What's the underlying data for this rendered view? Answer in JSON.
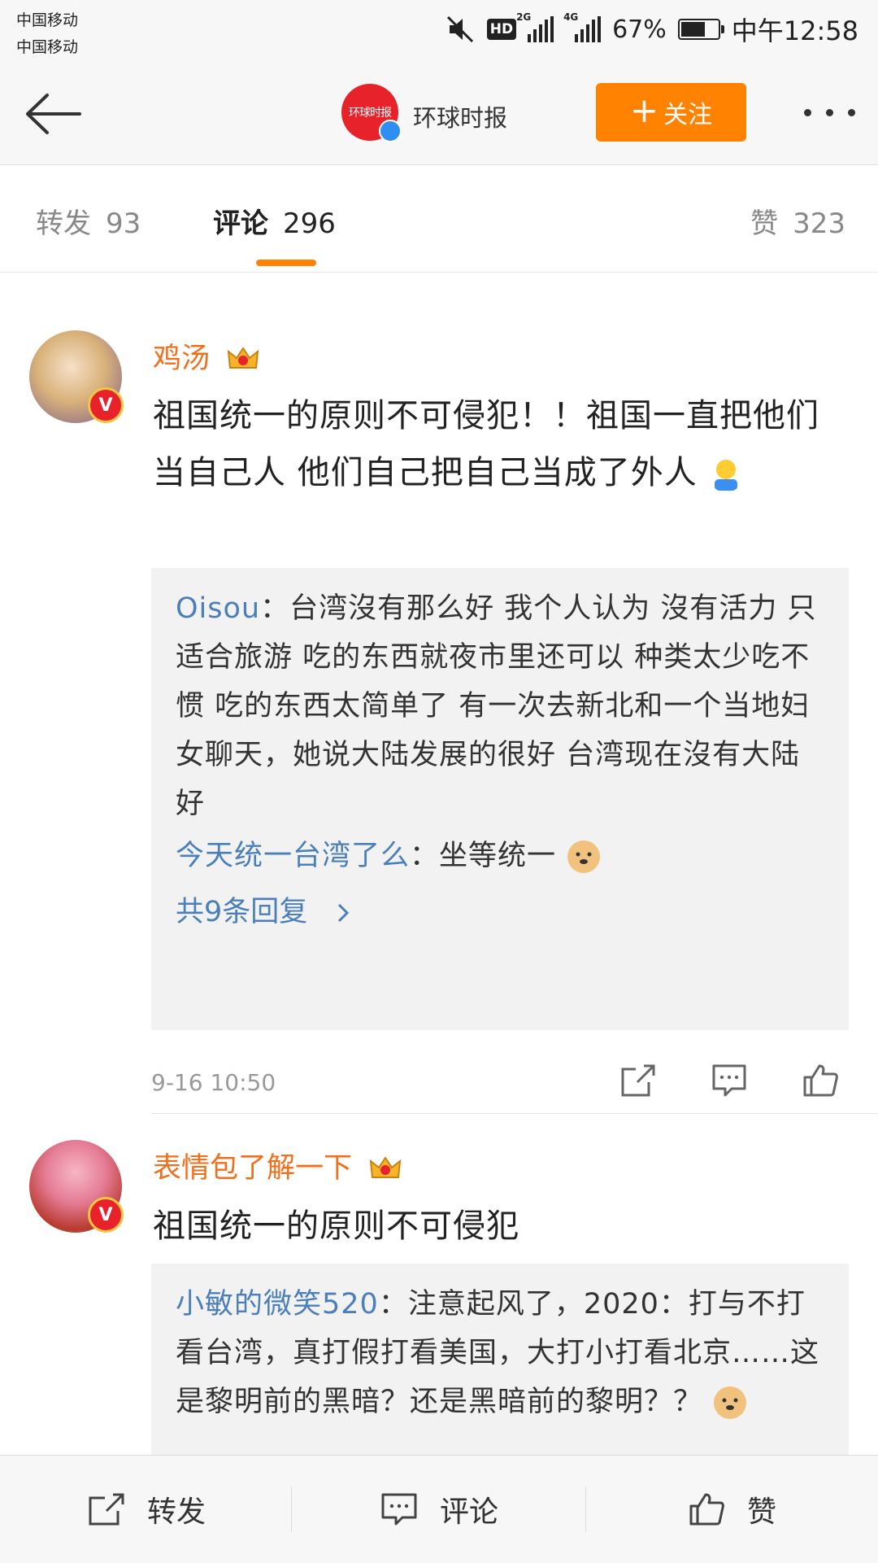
{
  "status_bar": {
    "carrier_1": "中国移动",
    "carrier_2": "中国移动",
    "hd": "HD",
    "sig1_tag": "2G",
    "sig2_tag": "4G",
    "battery": "67%",
    "battery_level": 0.67,
    "time": "中午12:58"
  },
  "nav": {
    "account_name": "环球时报",
    "logo_text": "环球时报",
    "follow_label": "关注",
    "follow_plus": "+"
  },
  "tabs": {
    "repost": {
      "label": "转发",
      "count": "93"
    },
    "comment": {
      "label": "评论",
      "count": "296"
    },
    "like": {
      "label": "赞",
      "count": "323"
    }
  },
  "comments": [
    {
      "username": "鸡汤",
      "text": "祖国统一的原则不可侵犯！！祖国一直把他们当自己人 他们自己把自己当成了外人",
      "replies": [
        {
          "who": "Oisou",
          "sep": "：",
          "text": "台湾沒有那么好 我个人认为 沒有活力 只适合旅游 吃的东西就夜市里还可以 种类太少吃不惯 吃的东西太简单了 有一次去新北和一个当地妇女聊天，她说大陆发展的很好 台湾现在沒有大陆好"
        },
        {
          "who": "今天统一台湾了么",
          "sep": "：",
          "text": "坐等统一"
        }
      ],
      "more_replies": "共9条回复",
      "time": "9-16 10:50"
    },
    {
      "username": "表情包了解一下",
      "text": "祖国统一的原则不可侵犯",
      "replies": [
        {
          "who": "小敏的微笑520",
          "sep": "：",
          "text": "注意起风了，2020：打与不打看台湾，真打假打看美国，大打小打看北京……这是黎明前的黑暗？还是黑暗前的黎明？？"
        }
      ]
    }
  ],
  "bottom_bar": {
    "repost": "转发",
    "comment": "评论",
    "like": "赞"
  },
  "colors": {
    "accent": "#ff8200",
    "username": "#f06f1d",
    "link": "#4a7fba",
    "verified_red": "#e8222a"
  }
}
